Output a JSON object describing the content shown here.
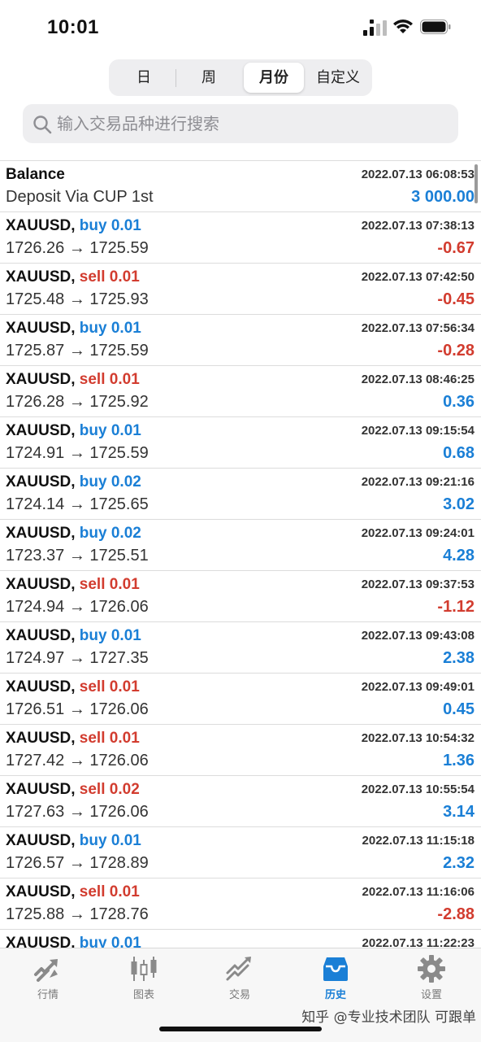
{
  "status_bar": {
    "time": "10:01"
  },
  "segments": {
    "day": "日",
    "week": "周",
    "month": "月份",
    "custom": "自定义",
    "selected": "月份"
  },
  "search": {
    "placeholder": "输入交易品种进行搜索",
    "value": ""
  },
  "balance": {
    "title": "Balance",
    "desc": "Deposit Via CUP 1st",
    "datetime": "2022.07.13 06:08:53",
    "amount": "3 000.00"
  },
  "trades": [
    {
      "symbol": "XAUUSD,",
      "side": "buy",
      "lots": "0.01",
      "open": "1726.26",
      "close": "1725.59",
      "datetime": "2022.07.13 07:38:13",
      "profit": "-0.67"
    },
    {
      "symbol": "XAUUSD,",
      "side": "sell",
      "lots": "0.01",
      "open": "1725.48",
      "close": "1725.93",
      "datetime": "2022.07.13 07:42:50",
      "profit": "-0.45"
    },
    {
      "symbol": "XAUUSD,",
      "side": "buy",
      "lots": "0.01",
      "open": "1725.87",
      "close": "1725.59",
      "datetime": "2022.07.13 07:56:34",
      "profit": "-0.28"
    },
    {
      "symbol": "XAUUSD,",
      "side": "sell",
      "lots": "0.01",
      "open": "1726.28",
      "close": "1725.92",
      "datetime": "2022.07.13 08:46:25",
      "profit": "0.36"
    },
    {
      "symbol": "XAUUSD,",
      "side": "buy",
      "lots": "0.01",
      "open": "1724.91",
      "close": "1725.59",
      "datetime": "2022.07.13 09:15:54",
      "profit": "0.68"
    },
    {
      "symbol": "XAUUSD,",
      "side": "buy",
      "lots": "0.02",
      "open": "1724.14",
      "close": "1725.65",
      "datetime": "2022.07.13 09:21:16",
      "profit": "3.02"
    },
    {
      "symbol": "XAUUSD,",
      "side": "buy",
      "lots": "0.02",
      "open": "1723.37",
      "close": "1725.51",
      "datetime": "2022.07.13 09:24:01",
      "profit": "4.28"
    },
    {
      "symbol": "XAUUSD,",
      "side": "sell",
      "lots": "0.01",
      "open": "1724.94",
      "close": "1726.06",
      "datetime": "2022.07.13 09:37:53",
      "profit": "-1.12"
    },
    {
      "symbol": "XAUUSD,",
      "side": "buy",
      "lots": "0.01",
      "open": "1724.97",
      "close": "1727.35",
      "datetime": "2022.07.13 09:43:08",
      "profit": "2.38"
    },
    {
      "symbol": "XAUUSD,",
      "side": "sell",
      "lots": "0.01",
      "open": "1726.51",
      "close": "1726.06",
      "datetime": "2022.07.13 09:49:01",
      "profit": "0.45"
    },
    {
      "symbol": "XAUUSD,",
      "side": "sell",
      "lots": "0.01",
      "open": "1727.42",
      "close": "1726.06",
      "datetime": "2022.07.13 10:54:32",
      "profit": "1.36"
    },
    {
      "symbol": "XAUUSD,",
      "side": "sell",
      "lots": "0.02",
      "open": "1727.63",
      "close": "1726.06",
      "datetime": "2022.07.13 10:55:54",
      "profit": "3.14"
    },
    {
      "symbol": "XAUUSD,",
      "side": "buy",
      "lots": "0.01",
      "open": "1726.57",
      "close": "1728.89",
      "datetime": "2022.07.13 11:15:18",
      "profit": "2.32"
    },
    {
      "symbol": "XAUUSD,",
      "side": "sell",
      "lots": "0.01",
      "open": "1725.88",
      "close": "1728.76",
      "datetime": "2022.07.13 11:16:06",
      "profit": "-2.88"
    },
    {
      "symbol": "XAUUSD,",
      "side": "buy",
      "lots": "0.01",
      "open": "",
      "close": "",
      "datetime": "2022.07.13 11:22:23",
      "profit": ""
    }
  ],
  "arrow": "→",
  "tabs": [
    {
      "label": "行情",
      "icon": "quotes-icon"
    },
    {
      "label": "图表",
      "icon": "chart-icon"
    },
    {
      "label": "交易",
      "icon": "trade-icon"
    },
    {
      "label": "历史",
      "icon": "history-icon",
      "active": true
    },
    {
      "label": "设置",
      "icon": "settings-icon"
    }
  ],
  "watermark": "知乎 @专业技术团队 可跟单",
  "colors": {
    "buy": "#1a7fd6",
    "sell": "#d23c2f",
    "active_tab": "#1a7fd6"
  }
}
